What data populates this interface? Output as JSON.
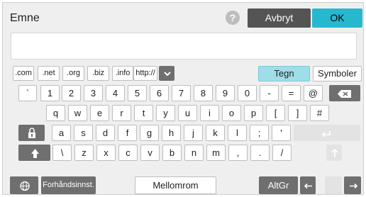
{
  "title": "Emne",
  "help_label": "?",
  "cancel_label": "Avbryt",
  "ok_label": "OK",
  "input_value": "",
  "domains": [
    ".com",
    ".net",
    ".org",
    ".biz",
    ".info",
    "http://"
  ],
  "mode_tabs": [
    "Tegn",
    "Symboler"
  ],
  "row1": [
    "`",
    "1",
    "2",
    "3",
    "4",
    "5",
    "6",
    "7",
    "8",
    "9",
    "0",
    "-",
    "="
  ],
  "at_key": "@",
  "row2": [
    "q",
    "w",
    "e",
    "r",
    "t",
    "y",
    "u",
    "i",
    "o",
    "p",
    "[",
    "]",
    "#"
  ],
  "row3": [
    "a",
    "s",
    "d",
    "f",
    "g",
    "h",
    "j",
    "k",
    "l",
    ";",
    "'"
  ],
  "row4": [
    "\\",
    "z",
    "x",
    "c",
    "v",
    "b",
    "n",
    "m",
    ",",
    ".",
    "/"
  ],
  "bottom": {
    "preset_label": "Forhåndsinnst.",
    "space_label": "Mellomrom",
    "altgr_label": "AltGr"
  },
  "icons": {
    "domain_menu": "chevron-down-icon",
    "backspace": "backspace-icon",
    "caps": "caps-lock-icon",
    "shift": "shift-arrow-icon",
    "globe": "globe-icon",
    "left": "arrow-left-icon",
    "right": "arrow-right-icon",
    "enter": "enter-icon"
  },
  "colors": {
    "ok": "#27b8cf",
    "cancel": "#545454",
    "tab_active": "#9fdde8",
    "dark_key": "#6f6f6f"
  }
}
